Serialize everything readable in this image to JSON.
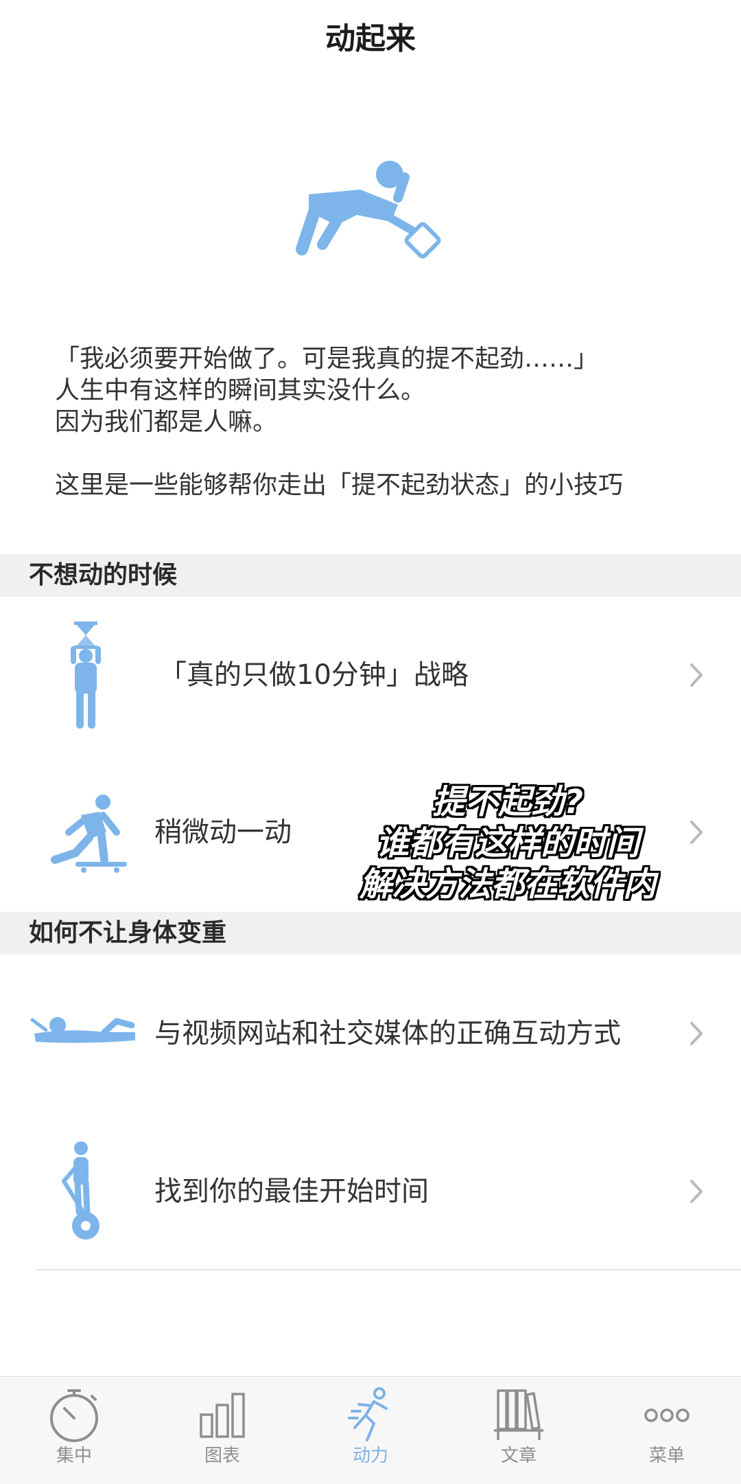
{
  "header": {
    "title": "动起来"
  },
  "hero": {
    "icon": "reclining-person-phone-icon"
  },
  "intro": {
    "lines": [
      "「我必须要开始做了。可是我真的提不起劲……」",
      "人生中有这样的瞬间其实没什么。",
      "因为我们都是人嘛。",
      "这里是一些能够帮你走出「提不起劲状态」的小技巧"
    ]
  },
  "sections": [
    {
      "title": "不想动的时候",
      "items": [
        {
          "label": "「真的只做10分钟」战略",
          "icon": "hourglass-person-icon"
        },
        {
          "label": "稍微动一动",
          "icon": "skateboarder-icon"
        }
      ]
    },
    {
      "title": "如何不让身体变重",
      "items": [
        {
          "label": "与视频网站和社交媒体的正确互动方式",
          "icon": "lying-person-phone-icon"
        },
        {
          "label": "找到你的最佳开始时间",
          "icon": "segway-person-icon"
        }
      ]
    }
  ],
  "overlay": {
    "lines": [
      "提不起劲?",
      "谁都有这样的时间",
      "解决方法都在软件内"
    ]
  },
  "tabbar": {
    "tabs": [
      {
        "label": "集中",
        "icon": "stopwatch-icon",
        "active": false
      },
      {
        "label": "图表",
        "icon": "bar-chart-icon",
        "active": false
      },
      {
        "label": "动力",
        "icon": "running-person-icon",
        "active": true
      },
      {
        "label": "文章",
        "icon": "bookshelf-icon",
        "active": false
      },
      {
        "label": "菜单",
        "icon": "more-dots-icon",
        "active": false
      }
    ]
  },
  "colors": {
    "accent": "#7fb2e5",
    "icon_blue": "#7db5ea",
    "section_bg": "#eff0f2",
    "inactive": "#8e8e8e"
  }
}
